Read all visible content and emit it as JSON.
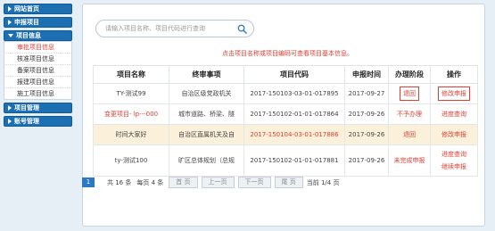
{
  "sidebar": {
    "groups": [
      {
        "label": "网站首页"
      },
      {
        "label": "申报项目"
      },
      {
        "label": "项目信息",
        "items": [
          {
            "label": "审批项目信息"
          },
          {
            "label": "核准项目信息"
          },
          {
            "label": "备案项目信息"
          },
          {
            "label": "报建项目信息"
          },
          {
            "label": "施工项目信息"
          }
        ]
      },
      {
        "label": "项目管理"
      },
      {
        "label": "账号管理"
      }
    ]
  },
  "search": {
    "placeholder": "请输入项目名称、项目代码进行查询"
  },
  "hint": "点击项目名称或项目编码可查看项目基本信息。",
  "table": {
    "headers": [
      "项目名称",
      "终审事项",
      "项目代码",
      "申报时间",
      "办理阶段",
      "操作"
    ],
    "rows": [
      {
        "name": "TY-测试99",
        "matter": "自治区级党政机关",
        "code": "2017-150103-03-01-017895",
        "date": "2017-09-27",
        "stage": "退回",
        "actions": [
          "修改申报"
        ]
      },
      {
        "name": "变更项目- lp---000",
        "matter": "城市道路、桥梁、隧",
        "code": "2017-150102-01-01-017864",
        "date": "2017-09-26",
        "stage": "不予办理",
        "actions": [
          "进度查询"
        ]
      },
      {
        "name": "时间大家好",
        "matter": "自治区直属机关及自",
        "code": "2017-150104-03-01-017886",
        "date": "2017-09-26",
        "stage": "退回",
        "actions": [
          "修改申报"
        ]
      },
      {
        "name": "ty-测试100",
        "matter": "旷区总体规划（总规",
        "code": "2017-150102-01-01-017881",
        "date": "2017-09-26",
        "stage": "未完成申报",
        "actions": [
          "进度查询",
          "继续申报"
        ]
      }
    ]
  },
  "pager": {
    "current": "1",
    "total_text": "共 16 条",
    "per_page_text": "每页 4 条",
    "first": "首 页",
    "prev": "上一页",
    "next": "下一页",
    "last": "尾 页",
    "position": "当前 1/4 页"
  },
  "colors": {
    "brand": "#1c6fb3",
    "accent_red": "#e03c31",
    "highlight_row": "#fbf1da"
  }
}
